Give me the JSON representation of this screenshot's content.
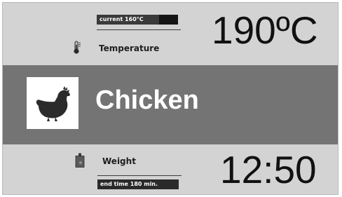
{
  "temperature": {
    "current_label": "current 160°C",
    "current_fraction": 0.77,
    "label": "Temperature",
    "value": "190ºC",
    "icon": "thermometer-icon"
  },
  "food": {
    "name": "Chicken",
    "icon": "chicken-icon"
  },
  "weight": {
    "label": "Weight",
    "icon": "weight-icon",
    "end_time_label": "end time 180 min.",
    "time_value": "12:50"
  },
  "colors": {
    "panel": "#d3d3d3",
    "band": "#747474",
    "text": "#111111"
  }
}
